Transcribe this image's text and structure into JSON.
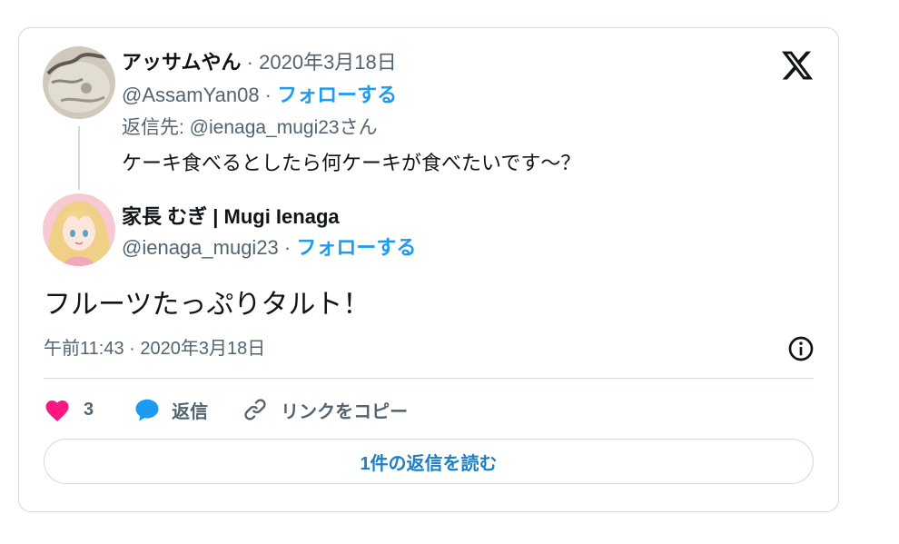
{
  "quoted_tweet": {
    "display_name": "アッサムやん",
    "separator": " · ",
    "date": "2020年3月18日",
    "handle": "@AssamYan08",
    "follow_label": "フォローする",
    "reply_to": "返信先: @ienaga_mugi23さん",
    "text": "ケーキ食べるとしたら何ケーキが食べたいです～？"
  },
  "main_tweet": {
    "display_name": "家長 むぎ | Mugi Ienaga",
    "handle": "@ienaga_mugi23",
    "separator": " · ",
    "follow_label": "フォローする",
    "text": "フルーツたっぷりタルト！",
    "timestamp": "午前11:43 · 2020年3月18日"
  },
  "actions": {
    "like_count": "3",
    "reply_label": "返信",
    "copy_link_label": "リンクをコピー"
  },
  "read_replies_label": "1件の返信を読む",
  "colors": {
    "accent": "#1d9bf0",
    "like": "#f91880",
    "muted": "#536471",
    "border": "#cfd9de"
  },
  "icons": [
    "x-logo-icon",
    "info-icon",
    "heart-icon",
    "reply-bubble-icon",
    "link-icon"
  ]
}
